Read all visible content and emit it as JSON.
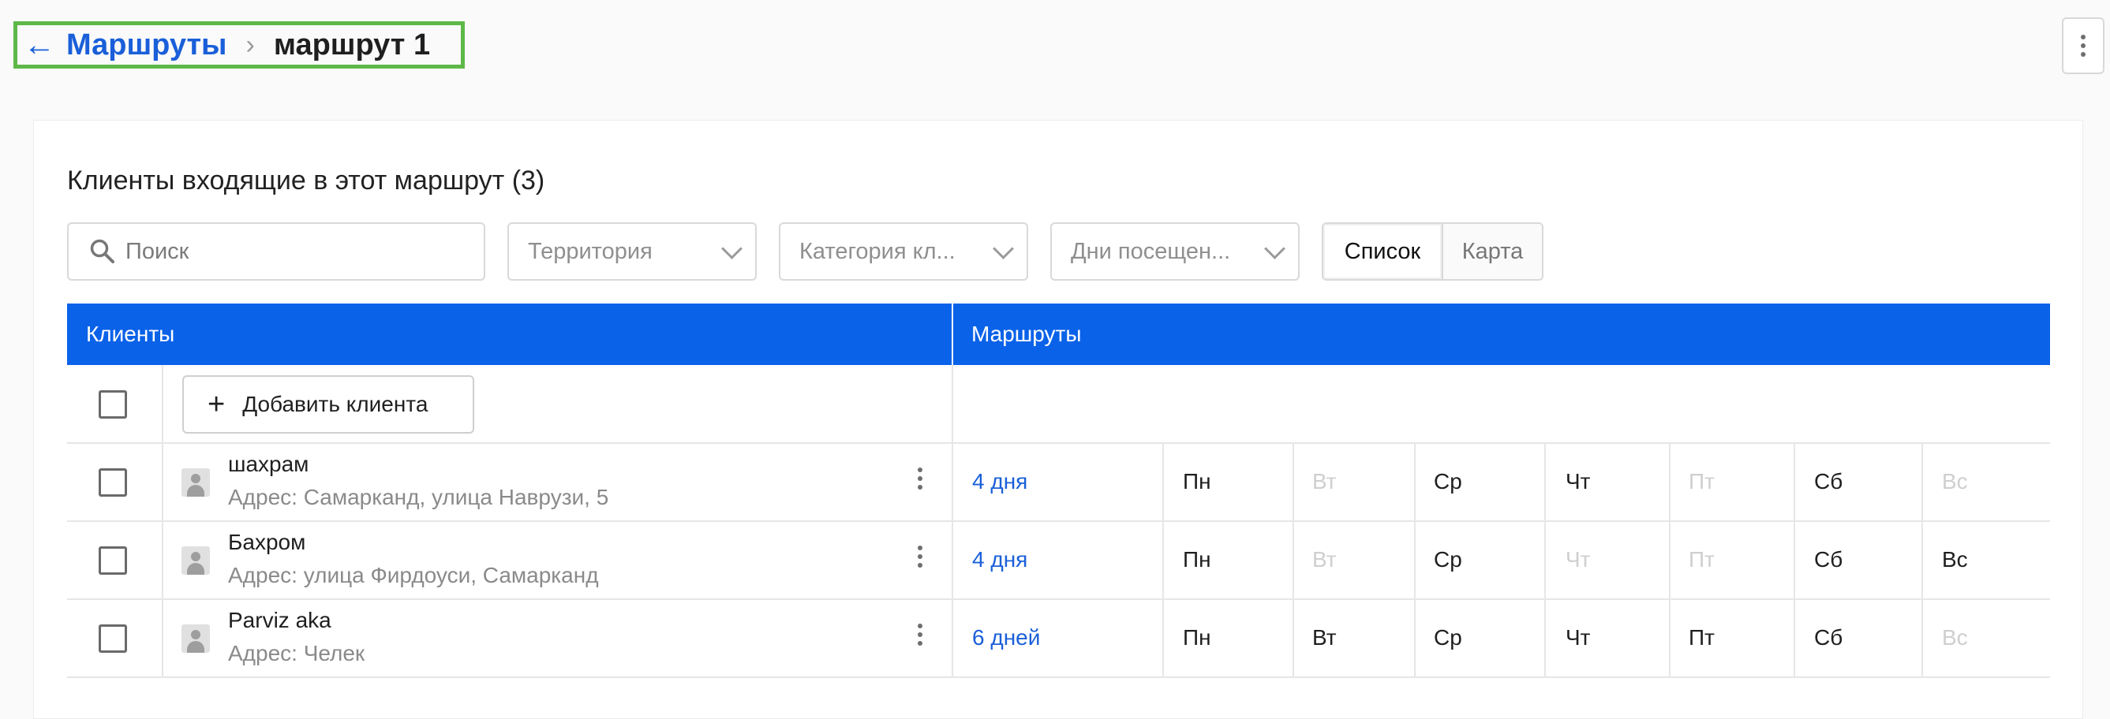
{
  "breadcrumb": {
    "back_label": "Маршруты",
    "current": "маршрут 1"
  },
  "section": {
    "title": "Клиенты входящие в этот маршрут (3)"
  },
  "filters": {
    "search_placeholder": "Поиск",
    "territory": "Территория",
    "category": "Категория кл...",
    "visit_days": "Дни посещен..."
  },
  "view_toggle": {
    "list": "Список",
    "map": "Карта",
    "selected": "Список"
  },
  "table": {
    "header_clients": "Клиенты",
    "header_routes": "Маршруты",
    "add_client": "Добавить клиента",
    "day_labels": [
      "Пн",
      "Вт",
      "Ср",
      "Чт",
      "Пт",
      "Сб",
      "Вс"
    ],
    "rows": [
      {
        "name": "шахрам",
        "address": "Адрес: Самарканд, улица Наврузи, 5",
        "frequency": "4 дня",
        "days": [
          true,
          false,
          true,
          true,
          false,
          true,
          false
        ]
      },
      {
        "name": "Бахром",
        "address": "Адрес: улица Фирдоуси, Самарканд",
        "frequency": "4 дня",
        "days": [
          true,
          false,
          true,
          false,
          false,
          true,
          true
        ]
      },
      {
        "name": "Parviz aka",
        "address": "Адрес: Челек",
        "frequency": "6 дней",
        "days": [
          true,
          true,
          true,
          true,
          true,
          true,
          false
        ]
      }
    ]
  },
  "colors": {
    "accent": "#0a62e8",
    "link": "#1a5fd9",
    "highlight_border": "#5db847",
    "day_inactive": "#cfcfcf"
  }
}
